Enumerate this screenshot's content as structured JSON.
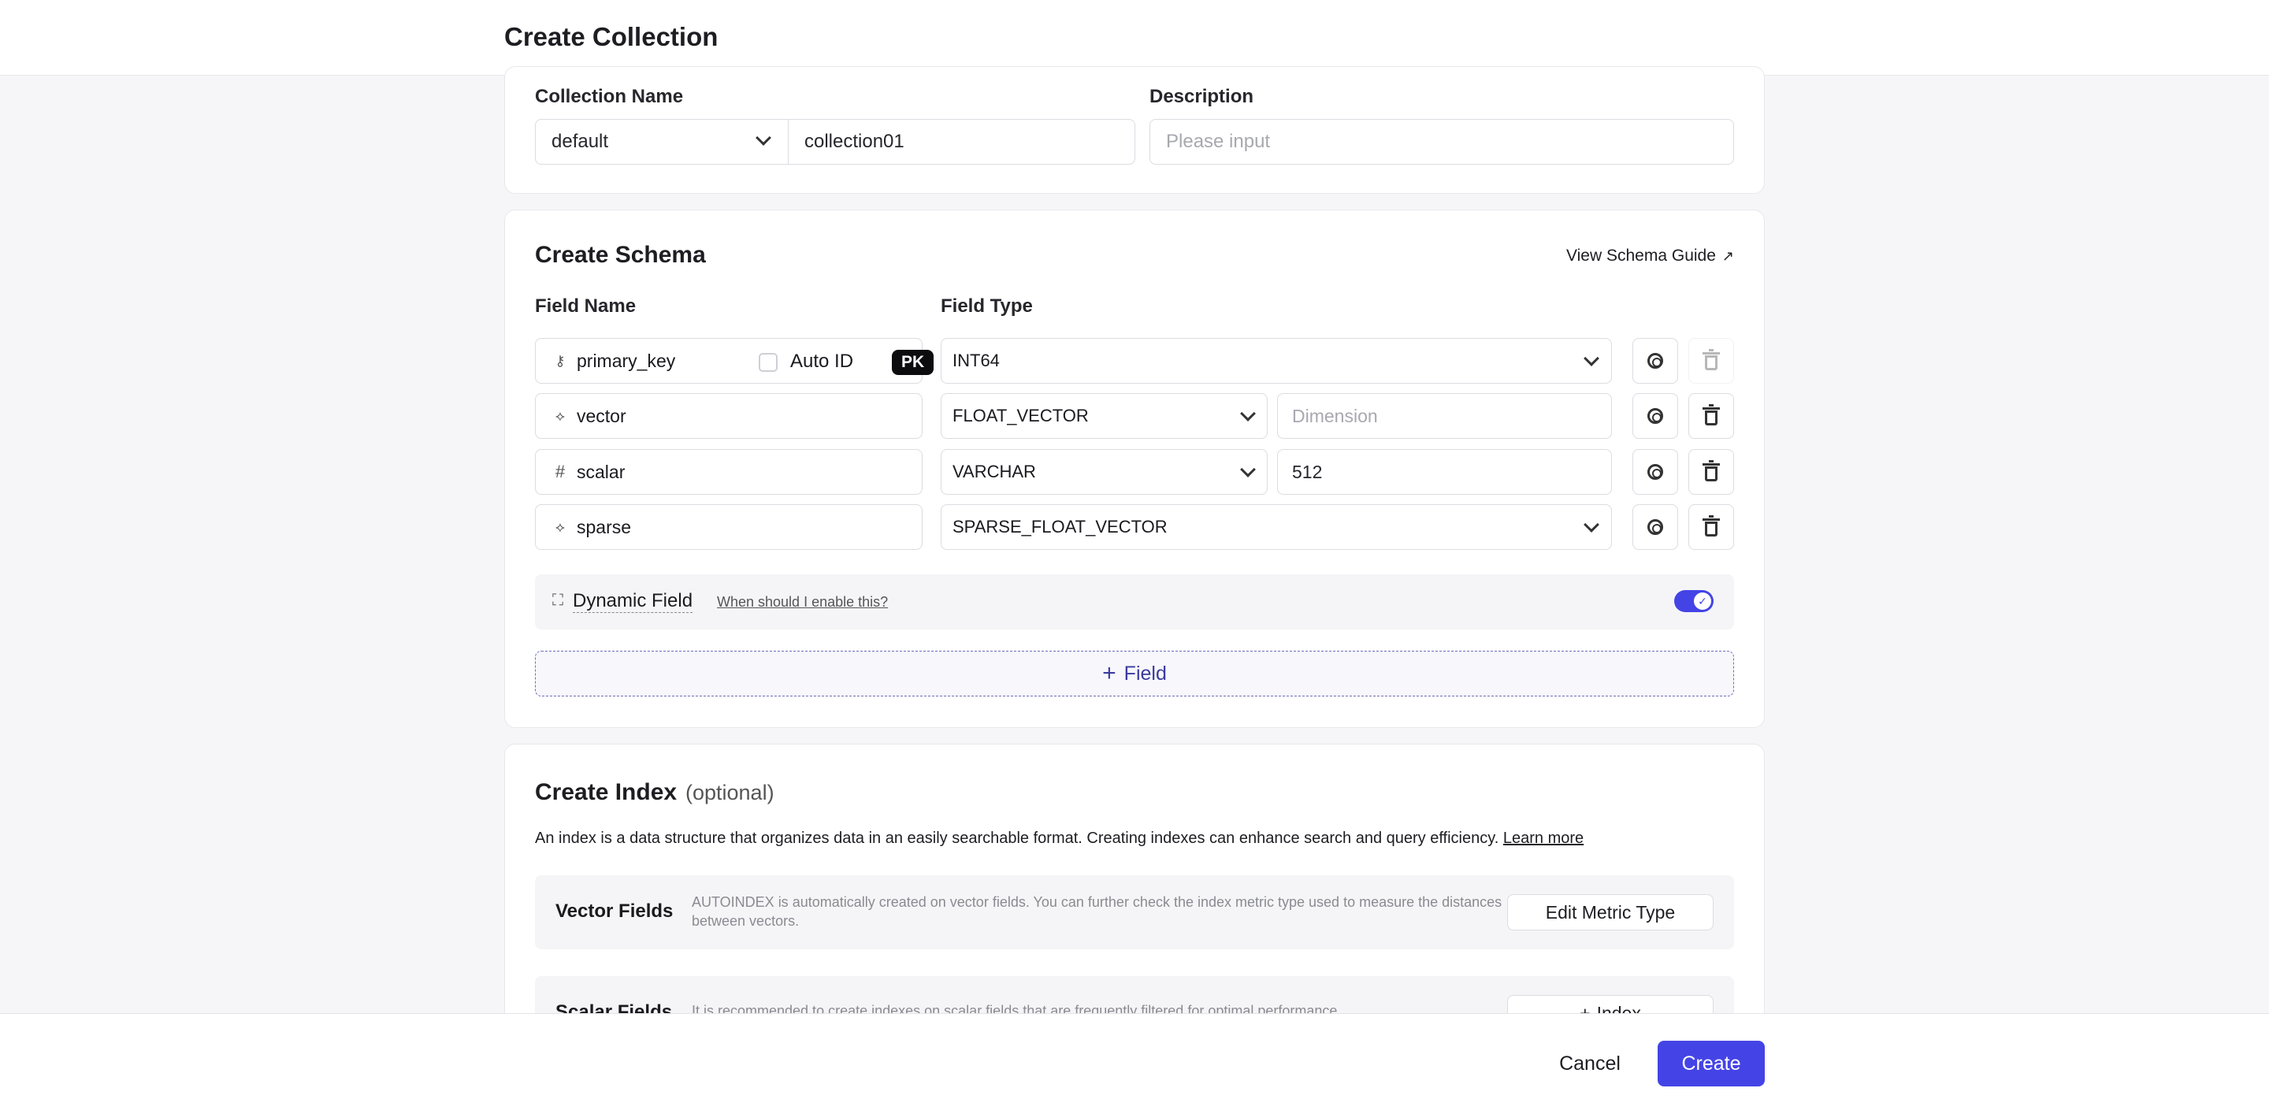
{
  "header": {
    "title": "Create Collection"
  },
  "basic": {
    "collection_name_label": "Collection Name",
    "database_select": "default",
    "collection_name_value": "collection01",
    "description_label": "Description",
    "description_placeholder": "Please input"
  },
  "schema": {
    "title": "Create Schema",
    "guide_link": "View Schema Guide",
    "field_name_label": "Field Name",
    "field_type_label": "Field Type",
    "fields": [
      {
        "name": "primary_key",
        "icon": "key-icon",
        "type": "INT64",
        "auto_id_label": "Auto ID",
        "badge": "PK"
      },
      {
        "name": "vector",
        "icon": "vector-icon",
        "type": "FLOAT_VECTOR",
        "dim_placeholder": "Dimension"
      },
      {
        "name": "scalar",
        "icon": "hash-icon",
        "type": "VARCHAR",
        "max_length": "512"
      },
      {
        "name": "sparse",
        "icon": "vector-icon",
        "type": "SPARSE_FLOAT_VECTOR"
      }
    ],
    "dynamic_field": {
      "label": "Dynamic Field",
      "help_link": "When should I enable this?",
      "enabled": true
    },
    "add_field_label": "Field"
  },
  "index": {
    "title": "Create Index",
    "optional": "(optional)",
    "description": "An index is a data structure that organizes data in an easily searchable format. Creating indexes can enhance search and query efficiency.",
    "learn_more": "Learn more",
    "vector_fields": {
      "label": "Vector Fields",
      "description": "AUTOINDEX is automatically created on vector fields. You can further check the index metric type used to measure the distances between vectors.",
      "button": "Edit Metric Type"
    },
    "scalar_fields": {
      "label": "Scalar Fields",
      "description": "It is recommended to create indexes on scalar fields that are frequently filtered for optimal performance.",
      "button": "Index"
    }
  },
  "footer": {
    "cancel": "Cancel",
    "create": "Create"
  },
  "colors": {
    "accent": "#4444e6"
  }
}
